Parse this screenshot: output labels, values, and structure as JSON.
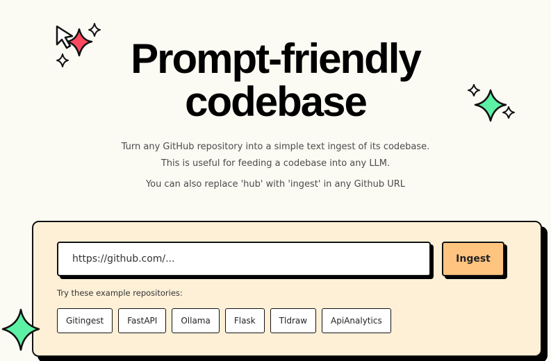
{
  "hero": {
    "title_line1": "Prompt-friendly",
    "title_line2": "codebase"
  },
  "description": {
    "line1": "Turn any GitHub repository into a simple text ingest of its codebase.",
    "line2": "This is useful for feeding a codebase into any LLM.",
    "line3": "You can also replace 'hub' with 'ingest' in any Github URL"
  },
  "form": {
    "url_placeholder": "https://github.com/...",
    "ingest_label": "Ingest"
  },
  "examples": {
    "label": "Try these example repositories:",
    "items": [
      "Gitingest",
      "FastAPI",
      "Ollama",
      "Flask",
      "Tldraw",
      "ApiAnalytics"
    ]
  },
  "colors": {
    "background": "#fbfaf3",
    "card": "#fdf0d7",
    "accent_button": "#ffc480",
    "sparkle_red": "#fe4a60",
    "sparkle_green": "#5cf1a4"
  },
  "icons": {
    "top_left": "cursor-sparkle-icon",
    "top_right": "sparkle-icon",
    "bottom_left": "star-icon"
  }
}
